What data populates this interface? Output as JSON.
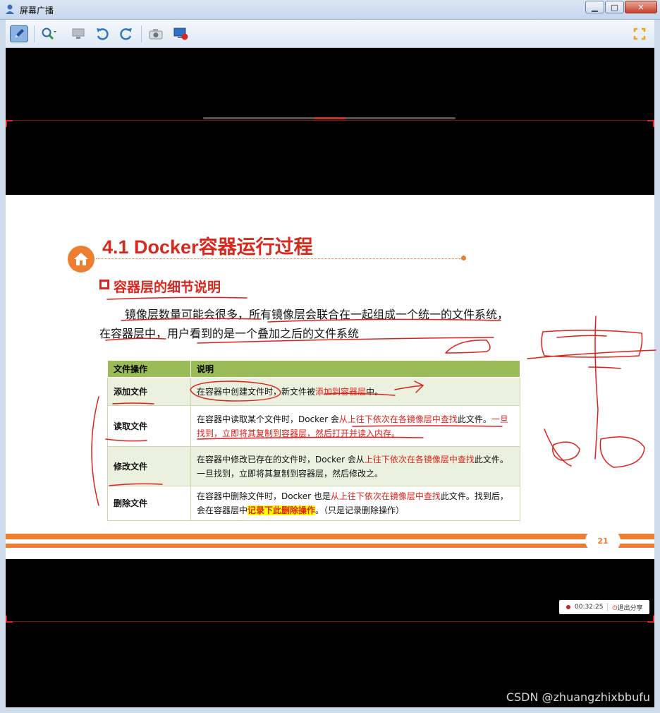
{
  "window": {
    "title": "屏幕广播",
    "minimize_label": "▁",
    "maximize_label": "□",
    "close_label": "✕"
  },
  "toolbar": {
    "icons": [
      "pen-icon",
      "zoom-icon",
      "monitor-icon",
      "undo-icon",
      "redo-icon",
      "camera-icon",
      "record-screen-icon",
      "fullscreen-icon"
    ]
  },
  "slide": {
    "title": "4.1 Docker容器运行过程",
    "section": "容器层的细节说明",
    "paragraph": "镜像层数量可能会很多，所有镜像层会联合在一起组成一个统一的文件系统，在容器层中，用户看到的是一个叠加之后的文件系统",
    "table": {
      "headers": [
        "文件操作",
        "说明"
      ],
      "rows": [
        {
          "op": "添加文件",
          "desc_1": "在容器中创建文件时，新文件被",
          "desc_red": "添加到容器层",
          "desc_2": "中。"
        },
        {
          "op": "读取文件",
          "desc_1": "在容器中读取某个文件时，Docker 会",
          "desc_red": "从上往下依次在各镜像层中查找",
          "desc_2": "此文件。",
          "desc_red2": "一旦找到，立即将其复制到容器层，然后打开并读入内存。"
        },
        {
          "op": "修改文件",
          "desc_1": "在容器中修改已存在的文件时，Docker 会从",
          "desc_red": "上往下依次在各镜像层中查找",
          "desc_2": "此文件。一旦找到，立即将其复制到容器层，然后修改之。"
        },
        {
          "op": "删除文件",
          "desc_1": "在容器中删除文件时，Docker 也是",
          "desc_red": "从上往下依次在镜像层中查找",
          "desc_2": "此文件。找到后，会在容器层中",
          "desc_hl": "记录下此删除操作",
          "desc_3": "。（只是记录删除操作）"
        }
      ]
    },
    "page_number": "21"
  },
  "share": {
    "elapsed": "00:32:25",
    "exit_label": "退出分享"
  },
  "watermark": "CSDN @zhuangzhixbbufu",
  "colors": {
    "accent": "#ed7d31",
    "title_red": "#d9281e",
    "table_header": "#9bbb59",
    "table_row": "#ebf1de",
    "ink": "#e0201b"
  }
}
